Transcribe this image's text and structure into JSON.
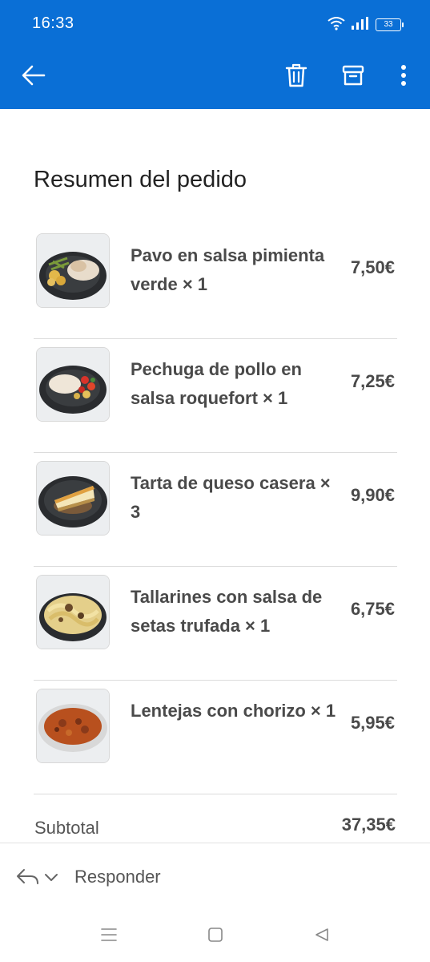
{
  "status_bar": {
    "time": "16:33",
    "battery": "33",
    "icons": [
      "wifi-icon",
      "signal-icon",
      "battery-icon"
    ]
  },
  "app_bar": {
    "back_icon": "arrow-left-icon",
    "delete_icon": "trash-icon",
    "archive_icon": "archive-icon",
    "more_icon": "more-vertical-icon"
  },
  "order": {
    "title": "Resumen del pedido",
    "items": [
      {
        "name": "Pavo en salsa pimienta verde × 1",
        "price": "7,50€",
        "image": "turkey-dish-photo"
      },
      {
        "name": "Pechuga de pollo en salsa roquefort × 1",
        "price": "7,25€",
        "image": "chicken-dish-photo"
      },
      {
        "name": "Tarta de queso casera × 3",
        "price": "9,90€",
        "image": "cheesecake-photo"
      },
      {
        "name": "Tallarines con salsa de setas trufada × 1",
        "price": "6,75€",
        "image": "tagliatelle-photo"
      },
      {
        "name": "Lentejas con chorizo × 1",
        "price": "5,95€",
        "image": "lentils-photo"
      }
    ],
    "subtotal_label": "Subtotal",
    "subtotal_value": "37,35€"
  },
  "reply": {
    "label": "Responder",
    "icons": [
      "reply-icon",
      "chevron-down-icon"
    ]
  },
  "nav_bar": {
    "icons": [
      "menu-icon",
      "home-icon",
      "back-triangle-icon"
    ]
  },
  "colors": {
    "header_blue": "#0a6fd6",
    "text_dark": "#4a4a4a",
    "divider": "#dcdcdc"
  }
}
